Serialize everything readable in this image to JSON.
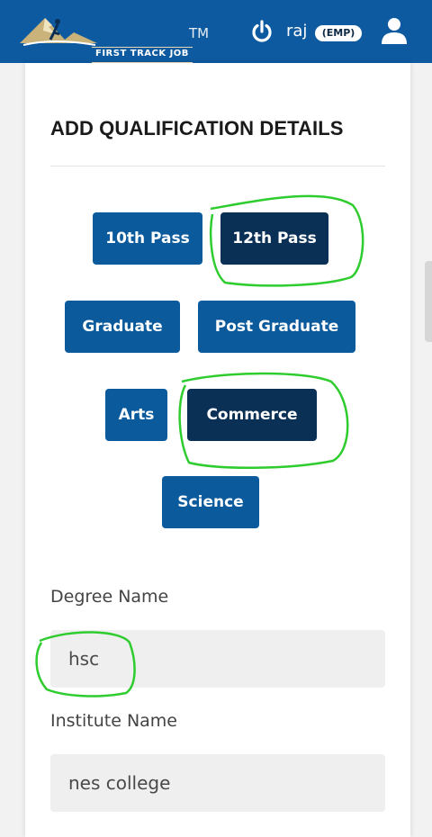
{
  "header": {
    "brand_tm": "TM",
    "brand_name": "FIRST TRACK JOB",
    "username": "raj",
    "role_badge": "(EMP)",
    "icons": [
      "power-icon",
      "user-icon"
    ],
    "colors": {
      "bar": "#0e5aa0"
    }
  },
  "form": {
    "title": "ADD QUALIFICATION DETAILS",
    "qualification_options": [
      {
        "label": "10th Pass",
        "selected": false
      },
      {
        "label": "12th Pass",
        "selected": true
      },
      {
        "label": "Graduate",
        "selected": false
      },
      {
        "label": "Post Graduate",
        "selected": false
      }
    ],
    "stream_options": [
      {
        "label": "Arts",
        "selected": false
      },
      {
        "label": "Commerce",
        "selected": true
      },
      {
        "label": "Science",
        "selected": false
      }
    ],
    "degree_label": "Degree Name",
    "degree_value": "hsc",
    "institute_label": "Institute Name",
    "institute_value": "nes college",
    "colors": {
      "button": "#0b5a9c",
      "selected": "#0b3056",
      "annotation": "#2ecc2e"
    }
  }
}
